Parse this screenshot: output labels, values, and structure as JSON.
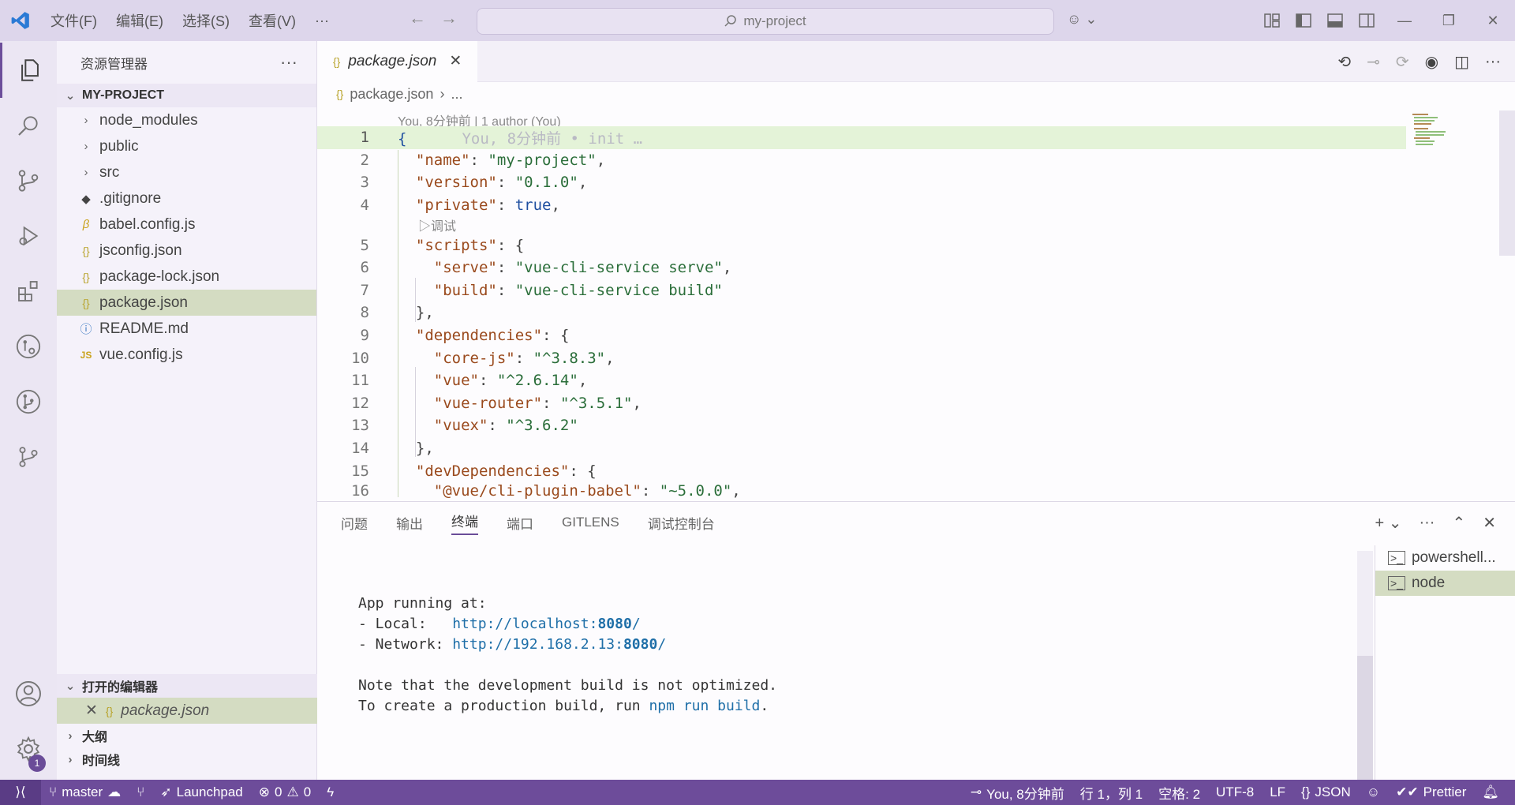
{
  "titlebar": {
    "menu": [
      "文件(F)",
      "编辑(E)",
      "选择(S)",
      "查看(V)",
      "···"
    ],
    "search_text": "my-project",
    "colors": {
      "titlebar": "#ddd6eb",
      "accent": "#6d4c9a"
    }
  },
  "sidebar": {
    "title": "资源管理器",
    "project": "MY-PROJECT",
    "folders": [
      "node_modules",
      "public",
      "src"
    ],
    "files": [
      {
        "name": ".gitignore",
        "icon": "git-icon"
      },
      {
        "name": "babel.config.js",
        "icon": "babel-icon"
      },
      {
        "name": "jsconfig.json",
        "icon": "json-icon"
      },
      {
        "name": "package-lock.json",
        "icon": "json-icon"
      },
      {
        "name": "package.json",
        "icon": "json-icon"
      },
      {
        "name": "README.md",
        "icon": "info-icon"
      },
      {
        "name": "vue.config.js",
        "icon": "js-icon"
      }
    ],
    "open_editors_label": "打开的编辑器",
    "open_editor_file": "package.json",
    "outline_label": "大纲",
    "timeline_label": "时间线",
    "badge_count": "1"
  },
  "editor": {
    "tab_label": "package.json",
    "breadcrumb_file": "package.json",
    "breadcrumb_more": "...",
    "blame_header": "You, 8分钟前 | 1 author (You)",
    "ghost_blame": "You, 8分钟前 • init …",
    "codelens": "▷调试",
    "lines": [
      {
        "n": "1",
        "key": "",
        "val": "{"
      },
      {
        "n": "2",
        "key": "\"name\"",
        "val": "\"my-project\""
      },
      {
        "n": "3",
        "key": "\"version\"",
        "val": "\"0.1.0\""
      },
      {
        "n": "4",
        "key": "\"private\"",
        "val": "true"
      },
      {
        "n": "5",
        "key": "\"scripts\"",
        "val": "{"
      },
      {
        "n": "6",
        "key": "\"serve\"",
        "val": "\"vue-cli-service serve\""
      },
      {
        "n": "7",
        "key": "\"build\"",
        "val": "\"vue-cli-service build\""
      },
      {
        "n": "8",
        "key": "",
        "val": "},"
      },
      {
        "n": "9",
        "key": "\"dependencies\"",
        "val": "{"
      },
      {
        "n": "10",
        "key": "\"core-js\"",
        "val": "\"^3.8.3\""
      },
      {
        "n": "11",
        "key": "\"vue\"",
        "val": "\"^2.6.14\""
      },
      {
        "n": "12",
        "key": "\"vue-router\"",
        "val": "\"^3.5.1\""
      },
      {
        "n": "13",
        "key": "\"vuex\"",
        "val": "\"^3.6.2\""
      },
      {
        "n": "14",
        "key": "",
        "val": "},"
      },
      {
        "n": "15",
        "key": "\"devDependencies\"",
        "val": "{"
      },
      {
        "n": "16",
        "key": "\"@vue/cli-plugin-babel\"",
        "val": "\"~5.0.0\""
      }
    ]
  },
  "panel": {
    "tabs": [
      "问题",
      "输出",
      "终端",
      "端口",
      "GITLENS",
      "调试控制台"
    ],
    "active_tab": "终端",
    "terminal": {
      "l1": "App running at:",
      "local_label": "- Local:   ",
      "local_url_pre": "http://localhost:",
      "local_port": "8080",
      "network_label": "- Network: ",
      "network_url_pre": "http://192.168.2.13:",
      "network_port": "8080",
      "slash": "/",
      "l4": "Note that the development build is not optimized.",
      "l5_pre": "To create a production build, run ",
      "l5_cmd": "npm run build",
      "l5_post": "."
    },
    "terminals": [
      "powershell...",
      "node"
    ]
  },
  "statusbar": {
    "branch": "master",
    "launchpad": "Launchpad",
    "errors": "0",
    "warnings": "0",
    "blame": "You, 8分钟前",
    "position": "行 1，列 1",
    "spaces": "空格: 2",
    "encoding": "UTF-8",
    "eol": "LF",
    "language": "JSON",
    "prettier": "Prettier"
  }
}
